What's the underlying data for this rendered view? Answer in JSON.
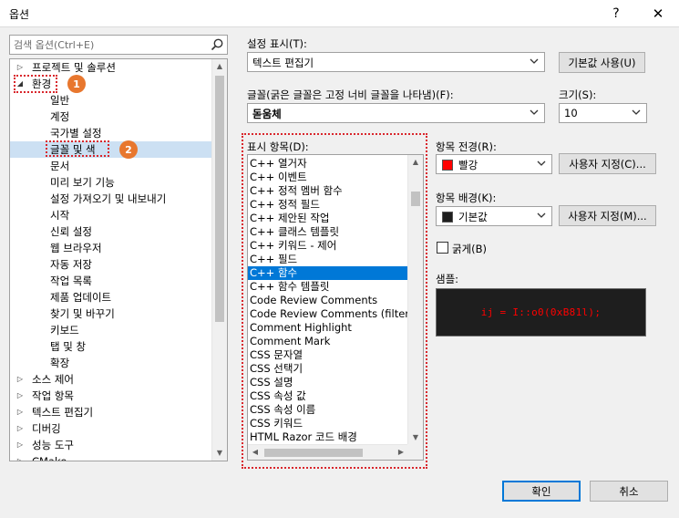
{
  "window": {
    "title": "옵션",
    "help_glyph": "?",
    "close_glyph": "✕"
  },
  "search": {
    "placeholder": "검색 옵션(Ctrl+E)"
  },
  "tree": {
    "items": [
      {
        "label": "프로젝트 및 솔루션",
        "arrow": "▷"
      },
      {
        "label": "환경",
        "arrow": "◢"
      },
      {
        "label": "일반"
      },
      {
        "label": "계정"
      },
      {
        "label": "국가별 설정"
      },
      {
        "label": "글꼴 및 색"
      },
      {
        "label": "문서"
      },
      {
        "label": "미리 보기 기능"
      },
      {
        "label": "설정 가져오기 및 내보내기"
      },
      {
        "label": "시작"
      },
      {
        "label": "신뢰 설정"
      },
      {
        "label": "웹 브라우저"
      },
      {
        "label": "자동 저장"
      },
      {
        "label": "작업 목록"
      },
      {
        "label": "제품 업데이트"
      },
      {
        "label": "찾기 및 바꾸기"
      },
      {
        "label": "키보드"
      },
      {
        "label": "탭 및 창"
      },
      {
        "label": "확장"
      },
      {
        "label": "소스 제어",
        "arrow": "▷"
      },
      {
        "label": "작업 항목",
        "arrow": "▷"
      },
      {
        "label": "텍스트 편집기",
        "arrow": "▷"
      },
      {
        "label": "디버깅",
        "arrow": "▷"
      },
      {
        "label": "성능 도구",
        "arrow": "▷"
      },
      {
        "label": "CMake",
        "arrow": "▷"
      }
    ],
    "selected_index": 5
  },
  "settings": {
    "show_settings_for_label": "설정 표시(T):",
    "show_settings_for_value": "텍스트 편집기",
    "use_defaults_button": "기본값 사용(U)",
    "font_label": "글꼴(굵은 글꼴은 고정 너비 글꼴을 나타냄)(F):",
    "font_value": "돋움체",
    "size_label": "크기(S):",
    "size_value": "10",
    "display_items_label": "표시 항목(D):",
    "display_items": [
      "C++ 열거자",
      "C++ 이벤트",
      "C++ 정적 멤버 함수",
      "C++ 정적 필드",
      "C++ 제안된 작업",
      "C++ 클래스 템플릿",
      "C++ 키워드 - 제어",
      "C++ 필드",
      "C++ 함수",
      "C++ 함수 템플릿",
      "Code Review Comments",
      "Code Review Comments (filtered)",
      "Comment Highlight",
      "Comment Mark",
      "CSS 문자열",
      "CSS 선택기",
      "CSS 설명",
      "CSS 속성 값",
      "CSS 속성 이름",
      "CSS 키워드",
      "HTML Razor 코드 배경"
    ],
    "display_items_selected": 8,
    "foreground_label": "항목 전경(R):",
    "foreground_value": "빨강",
    "foreground_color": "#ff0000",
    "custom_foreground_button": "사용자 지정(C)...",
    "background_label": "항목 배경(K):",
    "background_value": "기본값",
    "background_color": "#1e1e1e",
    "custom_background_button": "사용자 지정(M)...",
    "bold_label": "굵게(B)",
    "sample_label": "샘플:",
    "sample_text": "ij = I::o0(0xB81l);"
  },
  "footer": {
    "ok_button": "확인",
    "cancel_button": "취소"
  },
  "annotations": {
    "badge1": "1",
    "badge2": "2"
  },
  "colors": {
    "accent": "#0078d7",
    "highlight": "#d9262c",
    "badge": "#e8772e"
  }
}
